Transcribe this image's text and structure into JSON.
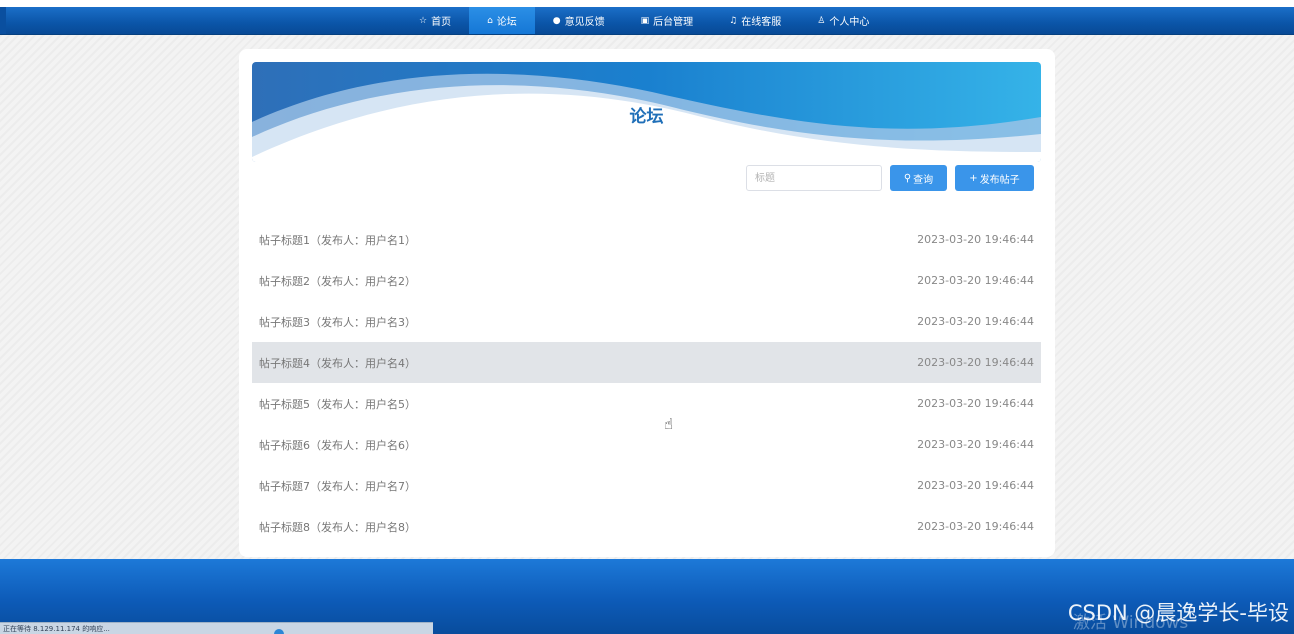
{
  "nav": {
    "items": [
      {
        "icon": "☆",
        "label": "首页"
      },
      {
        "icon": "⌂",
        "label": "论坛",
        "active": true
      },
      {
        "icon": "●",
        "label": "意见反馈"
      },
      {
        "icon": "▣",
        "label": "后台管理"
      },
      {
        "icon": "♫",
        "label": "在线客服"
      },
      {
        "icon": "♙",
        "label": "个人中心"
      }
    ]
  },
  "forum": {
    "title": "论坛",
    "search_placeholder": "标题",
    "query_label": "查询",
    "query_icon": "🔍",
    "post_label": "发布帖子",
    "post_icon": "+",
    "posts": [
      {
        "title": "帖子标题1（发布人：用户名1）",
        "date": "2023-03-20 19:46:44"
      },
      {
        "title": "帖子标题2（发布人：用户名2）",
        "date": "2023-03-20 19:46:44"
      },
      {
        "title": "帖子标题3（发布人：用户名3）",
        "date": "2023-03-20 19:46:44"
      },
      {
        "title": "帖子标题4（发布人：用户名4）",
        "date": "2023-03-20 19:46:44"
      },
      {
        "title": "帖子标题5（发布人：用户名5）",
        "date": "2023-03-20 19:46:44"
      },
      {
        "title": "帖子标题6（发布人：用户名6）",
        "date": "2023-03-20 19:46:44"
      },
      {
        "title": "帖子标题7（发布人：用户名7）",
        "date": "2023-03-20 19:46:44"
      },
      {
        "title": "帖子标题8（发布人：用户名8）",
        "date": "2023-03-20 19:46:44"
      }
    ]
  },
  "status_bar": {
    "text": "正在等待 8.129.11.174 的响应..."
  },
  "watermark": {
    "text": "CSDN @晨逸学长-毕设",
    "os_text": "激活 Windows"
  },
  "colors": {
    "accent": "#3a95ea",
    "nav_bg": "#0b55a8",
    "title": "#1f6fb8"
  }
}
